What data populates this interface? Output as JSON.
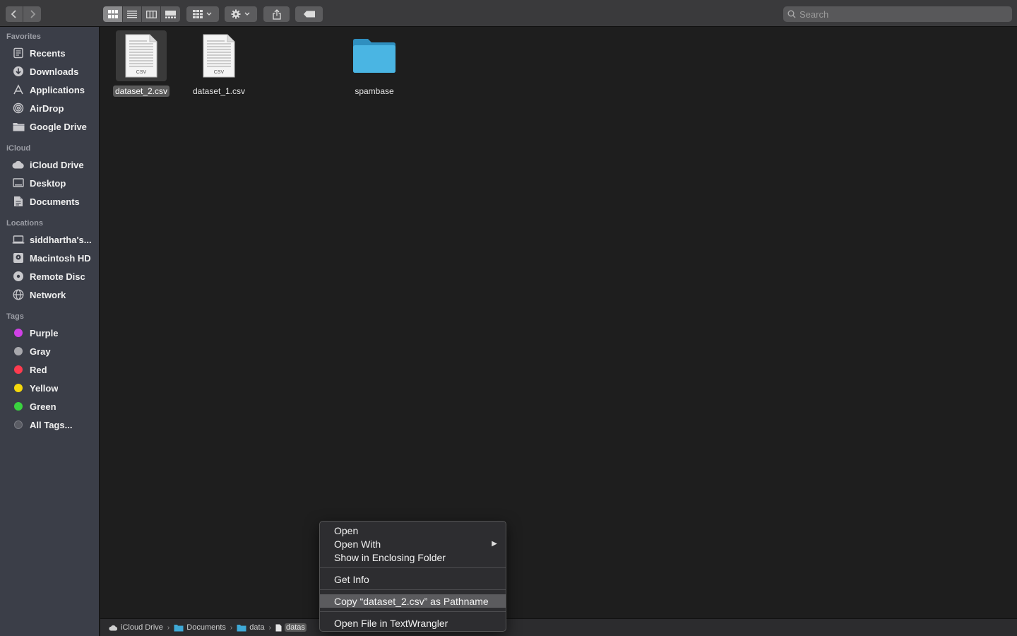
{
  "toolbar": {
    "search_placeholder": "Search"
  },
  "sidebar": {
    "favorites": {
      "label": "Favorites",
      "items": [
        {
          "label": "Recents",
          "icon": "recents-icon"
        },
        {
          "label": "Downloads",
          "icon": "downloads-icon"
        },
        {
          "label": "Applications",
          "icon": "applications-icon"
        },
        {
          "label": "AirDrop",
          "icon": "airdrop-icon"
        },
        {
          "label": "Google Drive",
          "icon": "folder-icon"
        }
      ]
    },
    "icloud": {
      "label": "iCloud",
      "items": [
        {
          "label": "iCloud Drive",
          "icon": "cloud-icon"
        },
        {
          "label": "Desktop",
          "icon": "desktop-icon"
        },
        {
          "label": "Documents",
          "icon": "document-icon"
        }
      ]
    },
    "locations": {
      "label": "Locations",
      "items": [
        {
          "label": "siddhartha's...",
          "icon": "laptop-icon"
        },
        {
          "label": "Macintosh HD",
          "icon": "disk-icon"
        },
        {
          "label": "Remote Disc",
          "icon": "disc-icon"
        },
        {
          "label": "Network",
          "icon": "globe-icon"
        }
      ]
    },
    "tags": {
      "label": "Tags",
      "items": [
        {
          "label": "Purple",
          "color": "#d041e6"
        },
        {
          "label": "Gray",
          "color": "#a8a8ad"
        },
        {
          "label": "Red",
          "color": "#ff3b4f"
        },
        {
          "label": "Yellow",
          "color": "#f5d80c"
        },
        {
          "label": "Green",
          "color": "#3ad23f"
        },
        {
          "label": "All Tags...",
          "color": "#5a5c64"
        }
      ]
    }
  },
  "files": [
    {
      "name": "dataset_2.csv",
      "badge": "CSV",
      "selected": true
    },
    {
      "name": "dataset_1.csv",
      "badge": "CSV",
      "selected": false
    },
    {
      "name": "spambase",
      "type": "folder",
      "selected": false
    }
  ],
  "pathbar": {
    "items": [
      "iCloud Drive",
      "Documents",
      "data",
      "datas"
    ]
  },
  "context_menu": {
    "items": [
      "Open",
      "Open With",
      "Show in Enclosing Folder",
      "Get Info",
      "Copy “dataset_2.csv” as Pathname",
      "Open File in TextWrangler"
    ],
    "highlighted_index": 4
  },
  "colors": {
    "sidebar_bg": "#3b3e48",
    "content_bg": "#1e1e1e",
    "folder_blue": "#3fa9d6"
  }
}
